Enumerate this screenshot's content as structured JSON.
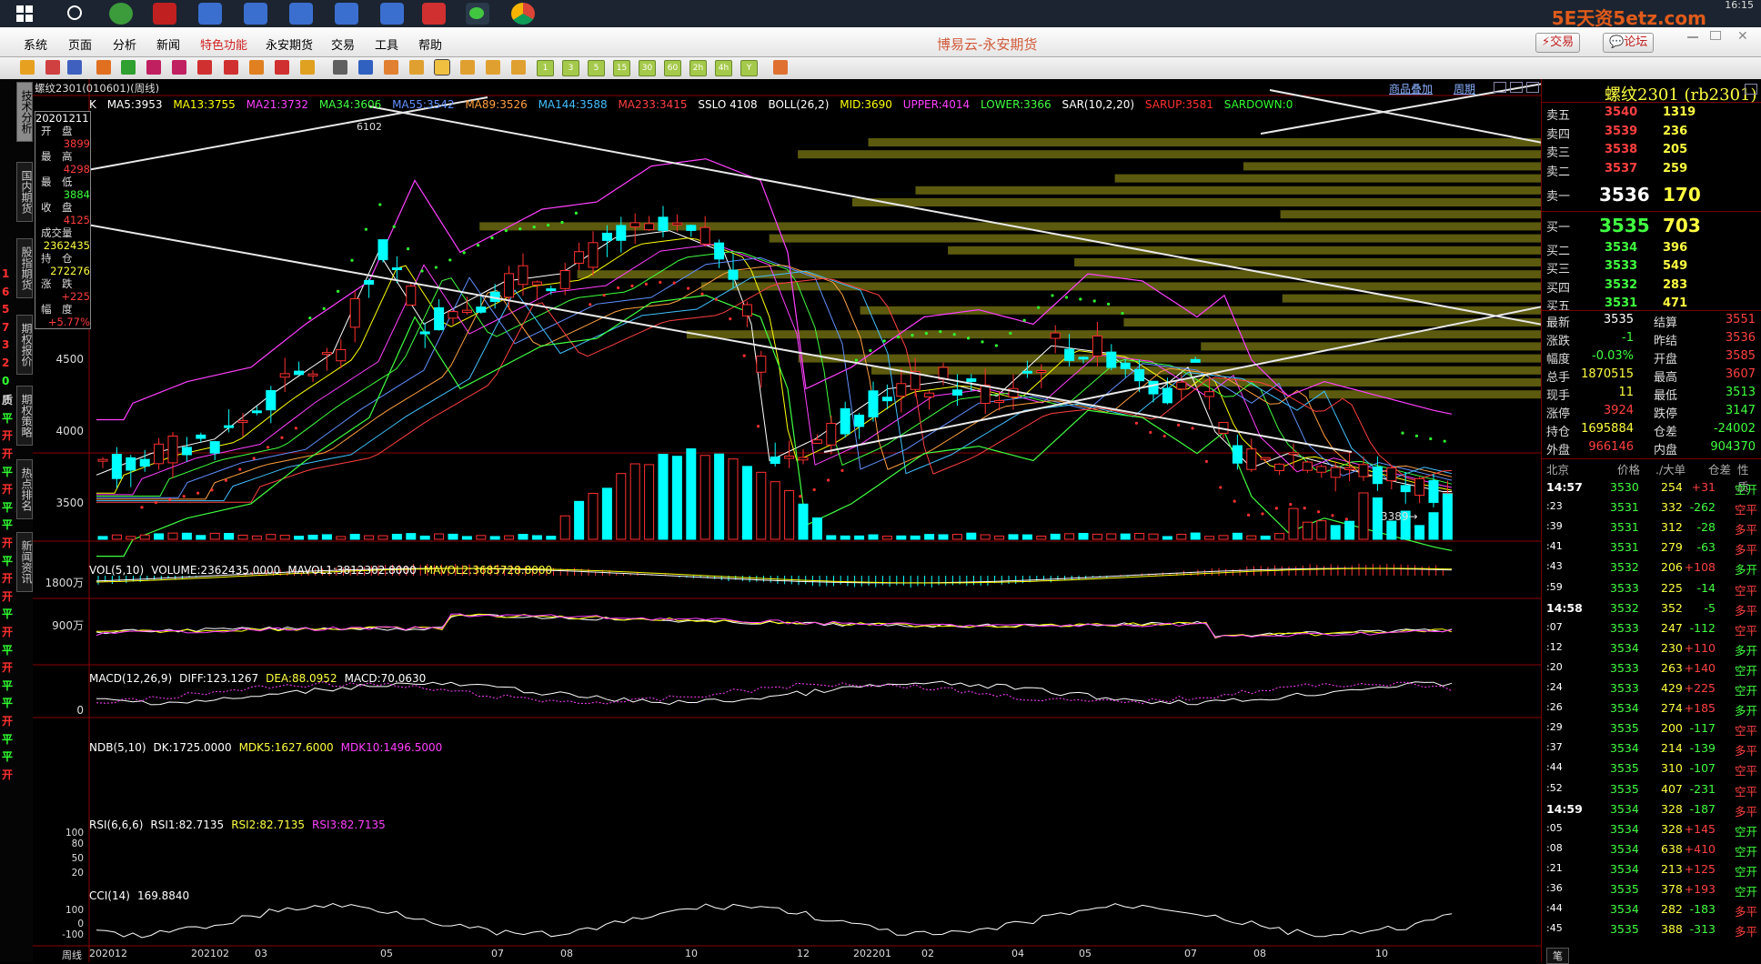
{
  "taskbar": {
    "logo_text": "5E天资5etz.com",
    "time": "16:15"
  },
  "menu": {
    "items": [
      "系统",
      "页面",
      "分析",
      "新闻",
      "特色功能",
      "永安期货",
      "交易",
      "工具",
      "帮助"
    ],
    "active_index": 4,
    "app_title": "博易云-永安期货",
    "trade_button": "交易",
    "forum_button": "论坛"
  },
  "toolbar": {
    "period_buttons": [
      "1",
      "3",
      "5",
      "15",
      "30",
      "60",
      "2h",
      "4h",
      "Y"
    ]
  },
  "left_tabs": {
    "items": [
      "技术分析",
      "国内期货",
      "股指期货",
      "期权报价",
      "期权策略",
      "热点排名",
      "新闻资讯"
    ],
    "markers": [
      "1",
      "6",
      "5",
      "7",
      "3",
      "2",
      "0",
      "质",
      "平",
      "开",
      "开",
      "平",
      "开",
      "平",
      "平",
      "开",
      "平",
      "开",
      "开",
      "平",
      "开",
      "平",
      "开",
      "平",
      "平",
      "开",
      "平",
      "平",
      "开"
    ]
  },
  "chart": {
    "symbol_title": "螺纹2301(010601)(周线)",
    "overlay_btn": "商品叠加",
    "period_btn": "周期",
    "ma_line": {
      "k": "K",
      "ma5": "MA5:3953",
      "ma13": "MA13:3755",
      "ma21": "MA21:3732",
      "ma34": "MA34:3606",
      "ma55": "MA55:3542",
      "ma89": "MA89:3526",
      "ma144": "MA144:3588",
      "ma233": "MA233:3415",
      "sslo": "SSLO 4108",
      "boll": "BOLL(26,2)",
      "mid": "MID:3690",
      "upper": "UPPER:4014",
      "lower": "LOWER:3366",
      "sar": "SAR(10,2,20)",
      "sarup": "SARUP:3581",
      "sardown": "SARDOWN:0"
    },
    "info_box": {
      "date": "20201211",
      "open_label": "开　盘",
      "open": "3899",
      "high_label": "最　高",
      "high": "4298",
      "low_label": "最　低",
      "low": "3884",
      "close_label": "收　盘",
      "close": "4125",
      "vol_label": "成交量",
      "vol": "2362435",
      "oi_label": "持　仓",
      "oi": "272276",
      "chg_label": "涨　跌",
      "chg": "+225",
      "pct_label": "幅　度",
      "pct": "+5.77%"
    },
    "price_axis": [
      "4500",
      "4000",
      "3500"
    ],
    "peak_label": "6102",
    "low_label": "3389→",
    "vol_panel": {
      "title": "VOL(5,10)",
      "volume": "VOLUME:2362435.0000",
      "mavol1": "MAVOL1:3812302.8000",
      "mavol2": "MAVOL2:3685728.8000",
      "axis": [
        "1800万",
        "900万"
      ]
    },
    "macd_panel": {
      "title": "MACD(12,26,9)",
      "diff": "DIFF:123.1267",
      "dea": "DEA:88.0952",
      "macd": "MACD:70.0630",
      "axis": [
        "0"
      ]
    },
    "ndb_panel": {
      "title": "NDB(5,10)",
      "dk": "DK:1725.0000",
      "mdk5": "MDK5:1627.6000",
      "mdk10": "MDK10:1496.5000"
    },
    "rsi_panel": {
      "title": "RSI(6,6,6)",
      "rsi1": "RSI1:82.7135",
      "rsi2": "RSI2:82.7135",
      "rsi3": "RSI3:82.7135",
      "axis": [
        "100",
        "80",
        "50",
        "20"
      ]
    },
    "cci_panel": {
      "title": "CCI(14)",
      "value": "169.8840",
      "axis": [
        "100",
        "0",
        "-100"
      ]
    },
    "x_axis": {
      "period_label": "周线",
      "dates": [
        "202012",
        "202102",
        "03",
        "05",
        "07",
        "08",
        "10",
        "12",
        "202201",
        "02",
        "04",
        "05",
        "07",
        "08",
        "10"
      ]
    }
  },
  "quote": {
    "title": "螺纹2301 (rb2301)",
    "asks": [
      {
        "label": "卖五",
        "price": "3540",
        "vol": "1319"
      },
      {
        "label": "卖四",
        "price": "3539",
        "vol": "236"
      },
      {
        "label": "卖三",
        "price": "3538",
        "vol": "205"
      },
      {
        "label": "卖二",
        "price": "3537",
        "vol": "259"
      },
      {
        "label": "卖一",
        "price": "3536",
        "vol": "170"
      }
    ],
    "bids": [
      {
        "label": "买一",
        "price": "3535",
        "vol": "703"
      },
      {
        "label": "买二",
        "price": "3534",
        "vol": "396"
      },
      {
        "label": "买三",
        "price": "3533",
        "vol": "549"
      },
      {
        "label": "买四",
        "price": "3532",
        "vol": "283"
      },
      {
        "label": "买五",
        "price": "3531",
        "vol": "471"
      }
    ],
    "stats": [
      {
        "l1": "最新",
        "v1": "3535",
        "l2": "结算",
        "v2": "3551"
      },
      {
        "l1": "涨跌",
        "v1": "-1",
        "l2": "昨结",
        "v2": "3536"
      },
      {
        "l1": "幅度",
        "v1": "-0.03%",
        "l2": "开盘",
        "v2": "3585"
      },
      {
        "l1": "总手",
        "v1": "1870515",
        "l2": "最高",
        "v2": "3607"
      },
      {
        "l1": "现手",
        "v1": "11",
        "l2": "最低",
        "v2": "3513"
      },
      {
        "l1": "涨停",
        "v1": "3924",
        "l2": "跌停",
        "v2": "3147"
      },
      {
        "l1": "持仓",
        "v1": "1695884",
        "l2": "仓差",
        "v2": "-24002"
      },
      {
        "l1": "外盘",
        "v1": "966146",
        "l2": "内盘",
        "v2": "904370"
      }
    ],
    "ticks_header": [
      "北京",
      "价格",
      "./大单",
      "仓差",
      "性质"
    ],
    "ticks": [
      {
        "t": "14:57",
        "p": "3530",
        "v": "254",
        "d": "+31",
        "n": "空开"
      },
      {
        "t": ":23",
        "p": "3531",
        "v": "332",
        "d": "-262",
        "n": "空平"
      },
      {
        "t": ":39",
        "p": "3531",
        "v": "312",
        "d": "-28",
        "n": "多平"
      },
      {
        "t": ":41",
        "p": "3531",
        "v": "279",
        "d": "-63",
        "n": "多平"
      },
      {
        "t": ":43",
        "p": "3532",
        "v": "206",
        "d": "+108",
        "n": "多开"
      },
      {
        "t": ":59",
        "p": "3533",
        "v": "225",
        "d": "-14",
        "n": "空平"
      },
      {
        "t": "14:58",
        "p": "3532",
        "v": "352",
        "d": "-5",
        "n": "多平"
      },
      {
        "t": ":07",
        "p": "3533",
        "v": "247",
        "d": "-112",
        "n": "空平"
      },
      {
        "t": ":12",
        "p": "3534",
        "v": "230",
        "d": "+110",
        "n": "多开"
      },
      {
        "t": ":20",
        "p": "3533",
        "v": "263",
        "d": "+140",
        "n": "空开"
      },
      {
        "t": ":24",
        "p": "3533",
        "v": "429",
        "d": "+225",
        "n": "空开"
      },
      {
        "t": ":26",
        "p": "3534",
        "v": "274",
        "d": "+185",
        "n": "多开"
      },
      {
        "t": ":29",
        "p": "3535",
        "v": "200",
        "d": "-117",
        "n": "空平"
      },
      {
        "t": ":37",
        "p": "3534",
        "v": "214",
        "d": "-139",
        "n": "多平"
      },
      {
        "t": ":44",
        "p": "3535",
        "v": "310",
        "d": "-107",
        "n": "空平"
      },
      {
        "t": ":52",
        "p": "3535",
        "v": "407",
        "d": "-231",
        "n": "空平"
      },
      {
        "t": "14:59",
        "p": "3534",
        "v": "328",
        "d": "-187",
        "n": "多平"
      },
      {
        "t": ":05",
        "p": "3534",
        "v": "328",
        "d": "+145",
        "n": "空开"
      },
      {
        "t": ":08",
        "p": "3534",
        "v": "638",
        "d": "+410",
        "n": "空开"
      },
      {
        "t": ":21",
        "p": "3534",
        "v": "213",
        "d": "+125",
        "n": "空开"
      },
      {
        "t": ":36",
        "p": "3535",
        "v": "378",
        "d": "+193",
        "n": "空开"
      },
      {
        "t": ":44",
        "p": "3534",
        "v": "282",
        "d": "-183",
        "n": "多平"
      },
      {
        "t": ":45",
        "p": "3535",
        "v": "388",
        "d": "-313",
        "n": "多平"
      }
    ],
    "footer_tab": "笔"
  }
}
